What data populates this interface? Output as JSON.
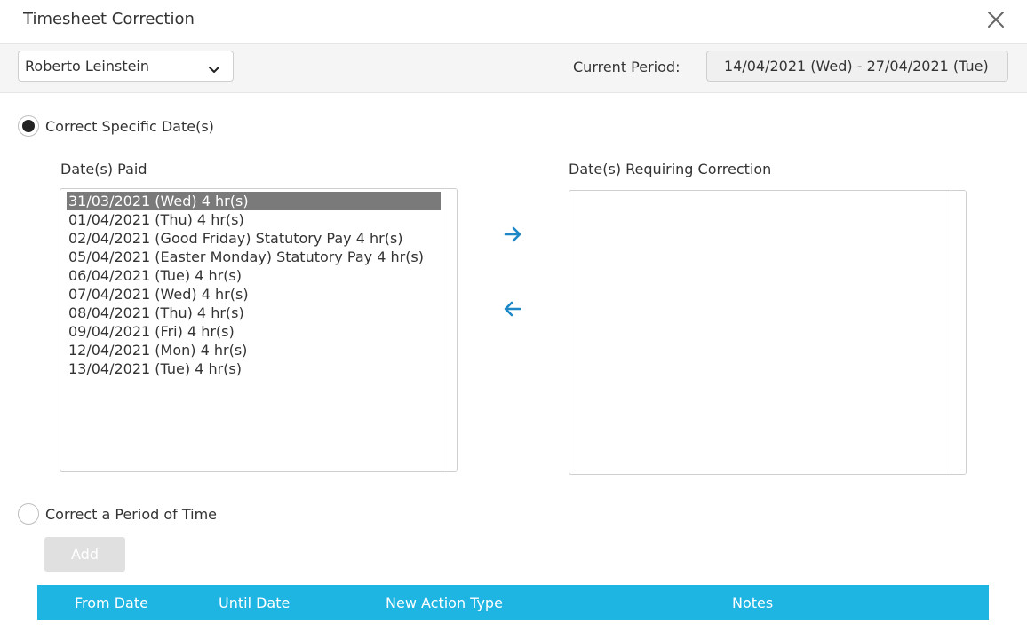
{
  "dialog": {
    "title": "Timesheet Correction"
  },
  "toolbar": {
    "employee": "Roberto Leinstein",
    "period_label": "Current Period:",
    "period_value": "14/04/2021 (Wed) - 27/04/2021 (Tue)"
  },
  "specific": {
    "label": "Correct Specific Date(s)",
    "checked": true,
    "paid_heading": "Date(s) Paid",
    "correction_heading": "Date(s) Requiring Correction",
    "paid_items": [
      "31/03/2021 (Wed) 4 hr(s)",
      "01/04/2021 (Thu) 4 hr(s)",
      "02/04/2021 (Good Friday) Statutory Pay 4 hr(s)",
      "05/04/2021 (Easter Monday) Statutory Pay 4 hr(s)",
      "06/04/2021 (Tue) 4 hr(s)",
      "07/04/2021 (Wed) 4 hr(s)",
      "08/04/2021 (Thu) 4 hr(s)",
      "09/04/2021 (Fri) 4 hr(s)",
      "12/04/2021 (Mon) 4 hr(s)",
      "13/04/2021 (Tue) 4 hr(s)"
    ],
    "selected_index": 0,
    "correction_items": []
  },
  "period": {
    "label": "Correct a Period of Time",
    "checked": false,
    "add_label": "Add"
  },
  "table": {
    "headers": [
      "From Date",
      "Until Date",
      "New Action Type",
      "Notes"
    ]
  },
  "colors": {
    "accent": "#1fb5e3",
    "arrow": "#1e88c7",
    "selected_row": "#7a7a7a"
  },
  "icons": {
    "close": "close-icon",
    "dropdown": "chevron-down-icon",
    "move_right": "arrow-right-icon",
    "move_left": "arrow-left-icon"
  }
}
